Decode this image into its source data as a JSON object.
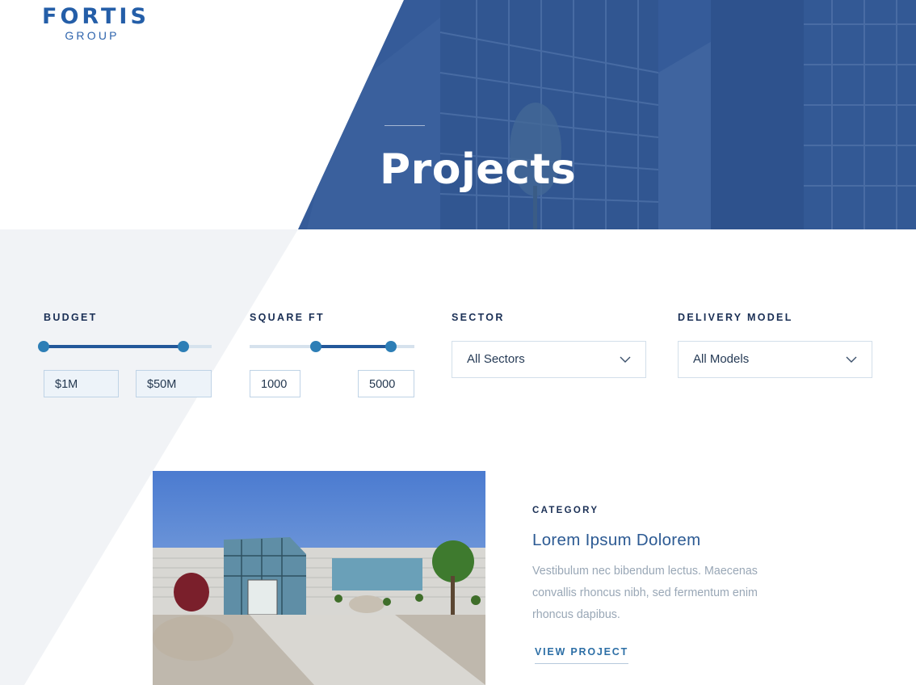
{
  "brand": {
    "name": "FORTIS",
    "subtitle": "GROUP"
  },
  "hero": {
    "title": "Projects"
  },
  "filters": {
    "budget": {
      "label": "BUDGET",
      "min_value": "$1M",
      "max_value": "$50M",
      "range_fraction": [
        0.0,
        0.83
      ]
    },
    "square_ft": {
      "label": "SQUARE FT",
      "min_value": "1000",
      "max_value": "5000",
      "range_fraction": [
        0.4,
        0.86
      ]
    },
    "sector": {
      "label": "SECTOR",
      "selected": "All Sectors"
    },
    "delivery_model": {
      "label": "DELIVERY MODEL",
      "selected": "All Models"
    }
  },
  "project": {
    "category": "CATEGORY",
    "title": "Lorem Ipsum Dolorem",
    "description": "Vestibulum nec bibendum lectus. Maecenas convallis rhoncus nibh, sed fermentum enim rhoncus dapibus.",
    "link": "VIEW PROJECT"
  },
  "icons": {
    "select_chevron": "chevron-down-icon"
  },
  "colors": {
    "brand_blue": "#245ea8",
    "hero_overlay": "#2d5694",
    "slider_fill": "#23589a",
    "slider_thumb": "#2d7eb6",
    "page_gray": "#f1f3f6"
  }
}
